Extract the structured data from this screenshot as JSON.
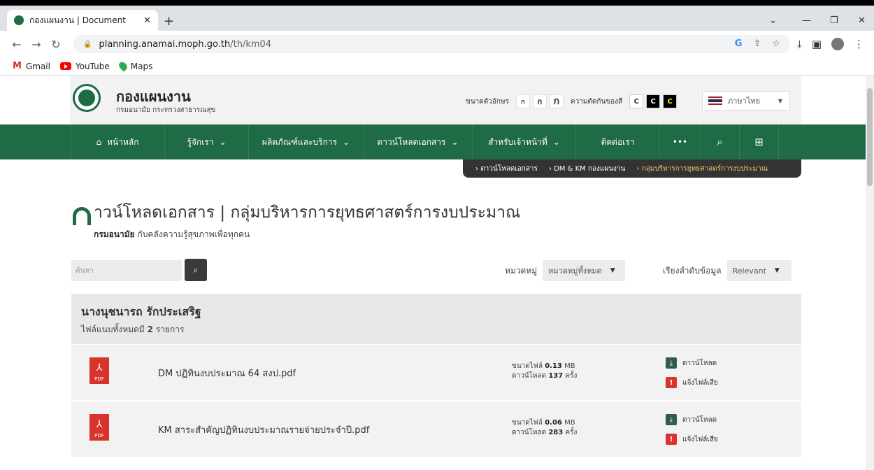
{
  "browser": {
    "tab_title": "กองแผนงาน | Document",
    "url_domain": "planning.anamai.moph.go.th",
    "url_path": "/th/km04",
    "bookmarks": [
      "Gmail",
      "YouTube",
      "Maps"
    ]
  },
  "header": {
    "site_title": "กองแผนงาน",
    "site_subtitle": "กรมอนามัย กระทรวงสาธารณสุข",
    "font_size_label": "ขนาดตัวอักษร",
    "font_size_options": [
      "ก",
      "ก",
      "ก"
    ],
    "contrast_label": "ความตัดกันของสี",
    "contrast_options": [
      "C",
      "C",
      "C"
    ],
    "language": "ภาษาไทย"
  },
  "nav": {
    "items": [
      "หน้าหลัก",
      "รู้จักเรา",
      "ผลิตภัณฑ์และบริการ",
      "ดาวน์โหลดเอกสาร",
      "สำหรับเจ้าหน้าที่",
      "ติดต่อเรา",
      "•••"
    ]
  },
  "breadcrumb": [
    "ดาวน์โหลดเอกสาร",
    "DM & KM กองแผนงาน",
    "กลุ่มบริหารการยุทธศาสตร์การงบประมาณ"
  ],
  "page": {
    "title": "ดาวน์โหลดเอกสาร | กลุ่มบริหารการยุทธศาสตร์การงบประมาณ",
    "title_tail": "าวน์โหลดเอกสาร | กลุ่มบริหารการยุทธศาสตร์การงบประมาณ",
    "subtitle_bold": "กรมอนามัย",
    "subtitle_rest": "กับคลังความรู้สุขภาพเพื่อทุกคน"
  },
  "search": {
    "placeholder": "ค้นหา"
  },
  "filters": {
    "category_label": "หมวดหมู่",
    "category_value": "หมวดหมู่ทั้งหมด",
    "sort_label": "เรียงลำดับข้อมูล",
    "sort_value": "Relevant"
  },
  "group": {
    "name": "นางนุชนารถ รักประเสริฐ",
    "count_prefix": "ไฟล์แนบทั้งหมดมี",
    "count": "2",
    "count_suffix": "รายการ"
  },
  "files": [
    {
      "name": "DM ปฏิทินงบประมาณ 64 สงป.pdf",
      "size_label": "ขนาดไฟล์",
      "size": "0.13",
      "size_unit": "MB",
      "downloads_label": "ดาวน์โหลด",
      "downloads": "137",
      "downloads_unit": "ครั้ง",
      "download_action": "ดาวน์โหลด",
      "report_action": "แจ้งไฟล์เสีย"
    },
    {
      "name": "KM สาระสำคัญปฏิทินงบประมาณรายจ่ายประจำปี.pdf",
      "size_label": "ขนาดไฟล์",
      "size": "0.06",
      "size_unit": "MB",
      "downloads_label": "ดาวน์โหลด",
      "downloads": "283",
      "downloads_unit": "ครั้ง",
      "download_action": "ดาวน์โหลด",
      "report_action": "แจ้งไฟล์เสีย"
    }
  ],
  "pdf_badge": "PDF"
}
